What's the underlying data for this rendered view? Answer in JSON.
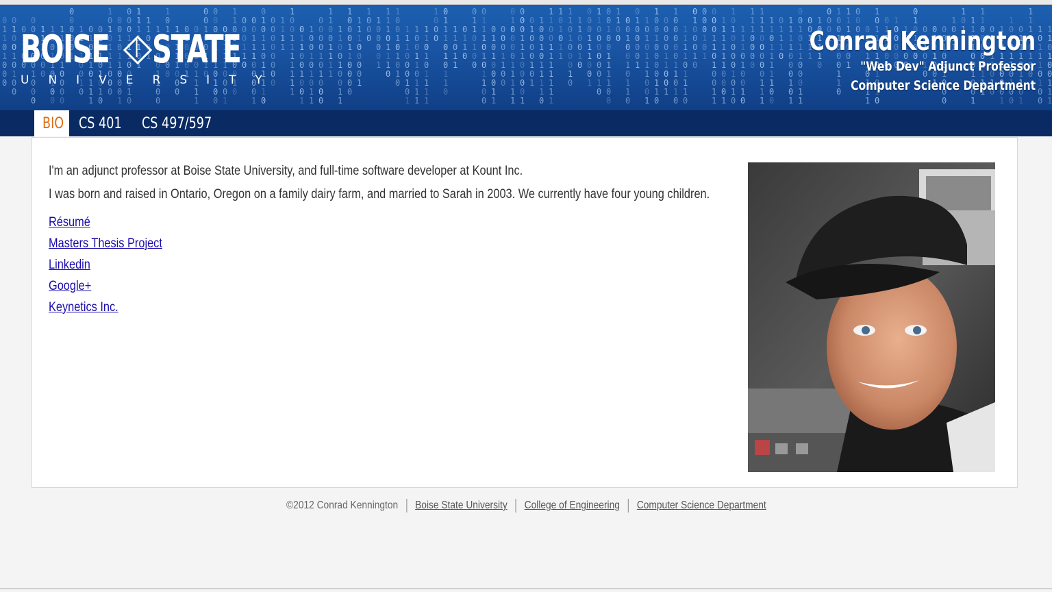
{
  "header": {
    "logo_main_left": "BOISE",
    "logo_main_right": "STATE",
    "logo_sub": "UNIVERSITY",
    "name": "Conrad Kennington",
    "title": "\"Web Dev\" Adjunct Professor",
    "department": "Computer Science Department"
  },
  "nav": {
    "tabs": [
      {
        "label": "BIO",
        "active": true
      },
      {
        "label": "CS 401",
        "active": false
      },
      {
        "label": "CS 497/597",
        "active": false
      }
    ]
  },
  "bio": {
    "line1": "I'm an adjunct professor at Boise State University, and full-time software developer at Kount Inc.",
    "line2": "I was born and raised in Ontario, Oregon on a family dairy farm, and married to Sarah in 2003. We currently have four young children.",
    "links": [
      "Résumé",
      "Masters Thesis Project",
      "Linkedin",
      "Google+",
      "Keynetics Inc."
    ]
  },
  "footer": {
    "copyright": "©2012 Conrad Kennington",
    "links": [
      "Boise State University",
      "College of Engineering",
      "Computer Science Department"
    ]
  },
  "colors": {
    "header_blue": "#1a55a4",
    "nav_navy": "#0a2a63",
    "active_tab_orange": "#e06b10",
    "link_blue": "#1a0dab"
  }
}
